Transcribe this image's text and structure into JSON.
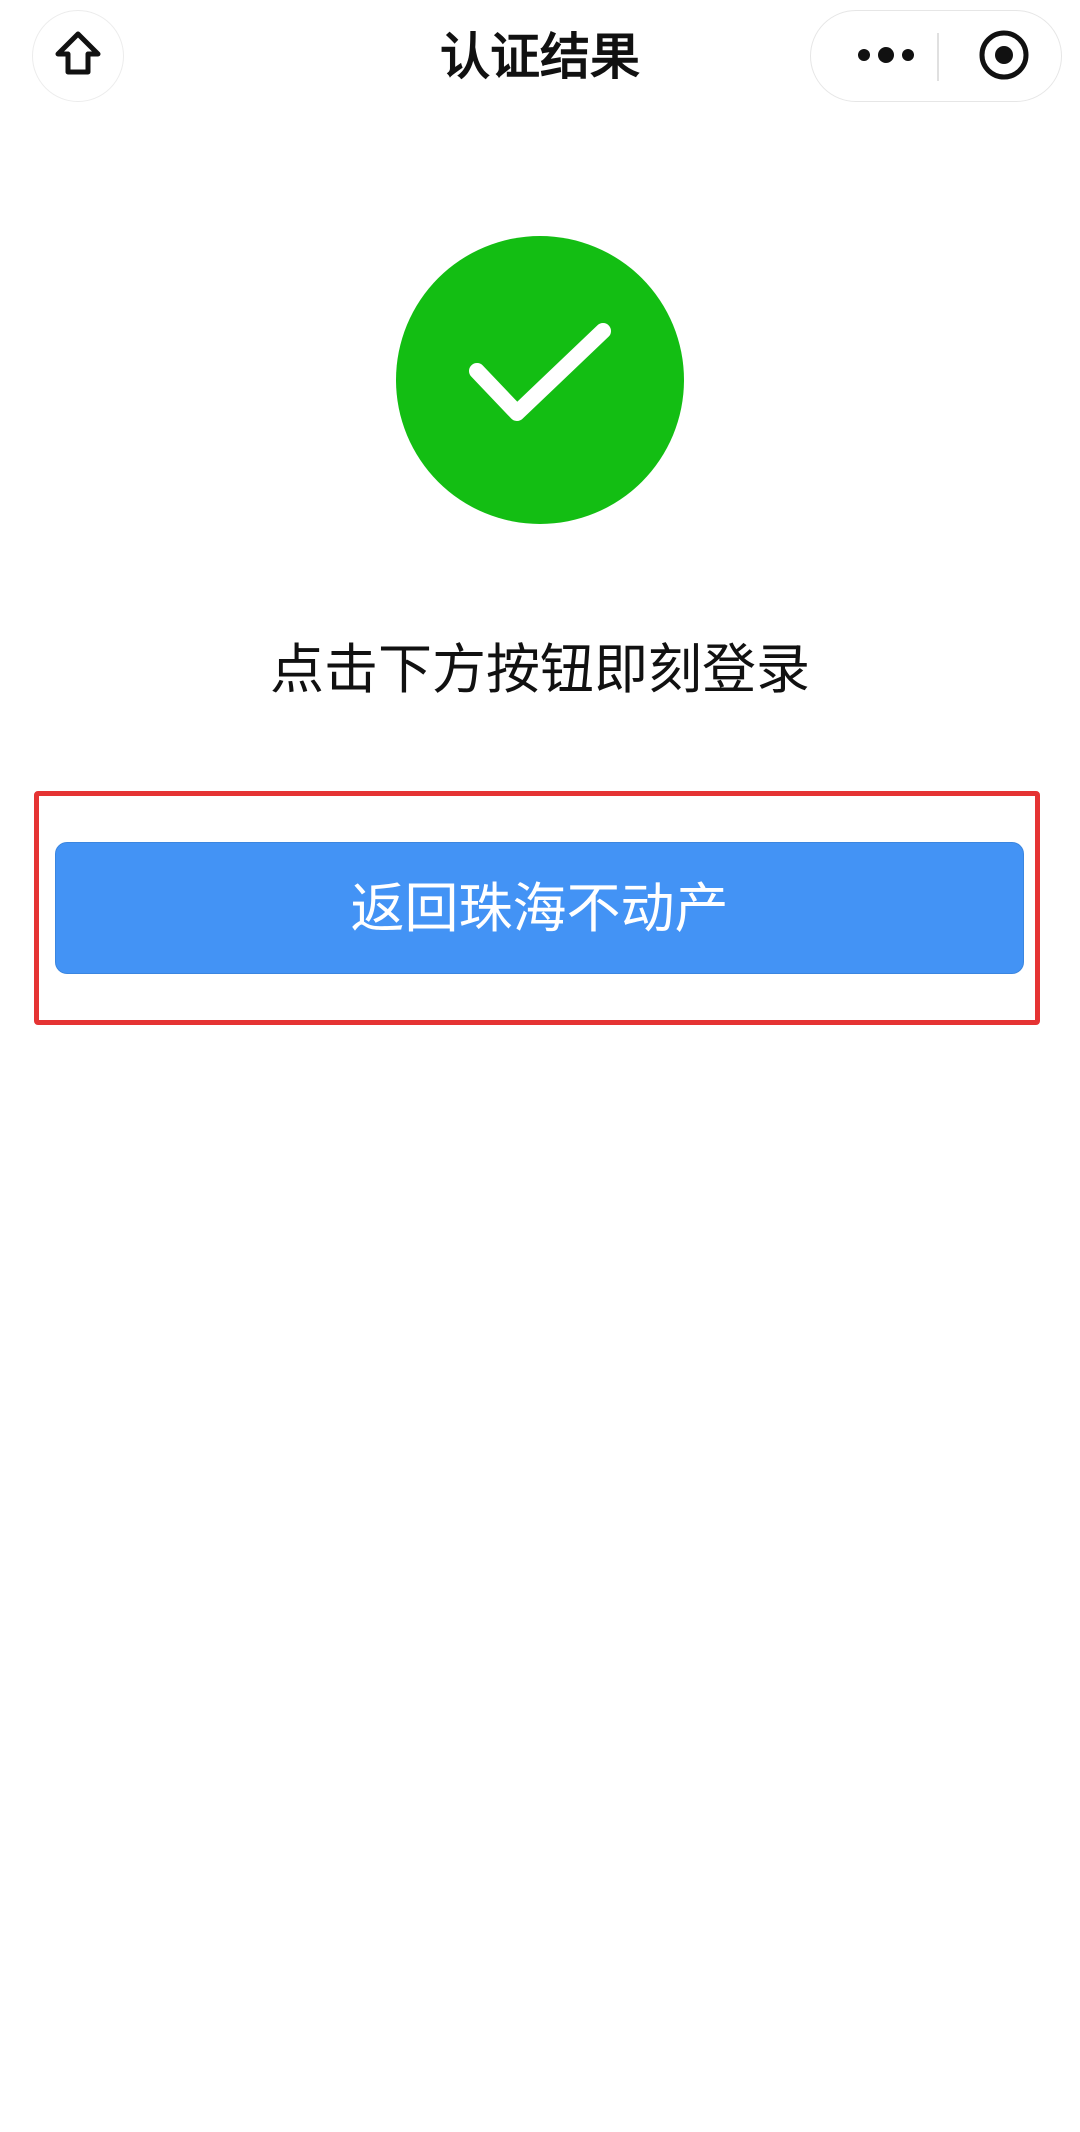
{
  "header": {
    "title": "认证结果",
    "icons": {
      "home": "home-icon",
      "more": "more-dots-icon",
      "close": "target-close-icon"
    }
  },
  "main": {
    "status_icon": "check-circle-icon",
    "instruction": "点击下方按钮即刻登录",
    "button_label": "返回珠海不动产"
  },
  "colors": {
    "success_green": "#13be13",
    "button_blue": "#4393f5",
    "highlight_red": "#e53333"
  }
}
